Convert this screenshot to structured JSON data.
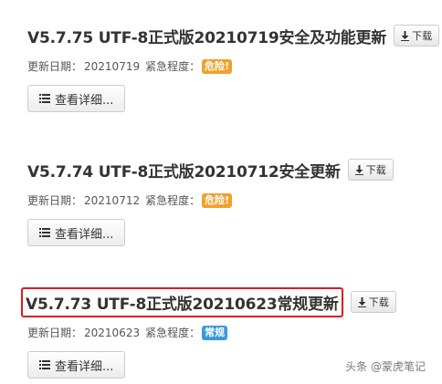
{
  "labels": {
    "update_date": "更新日期：",
    "urgency": "紧急程度：",
    "download": "下载",
    "details": "查看详细..."
  },
  "entries": [
    {
      "title": "V5.7.75 UTF-8正式版20210719安全及功能更新",
      "date": "20210719",
      "urgency": "危险!",
      "urgency_color": "#f0a12c"
    },
    {
      "title": "V5.7.74 UTF-8正式版20210712安全更新",
      "date": "20210712",
      "urgency": "危险!",
      "urgency_color": "#f0a12c"
    },
    {
      "title": "V5.7.73 UTF-8正式版20210623常规更新",
      "date": "20210623",
      "urgency": "常规",
      "urgency_color": "#3a9ad9"
    }
  ],
  "watermark": {
    "text": "头条 @蒙虎笔记"
  },
  "colors": {
    "highlight_border": "#e0191f"
  },
  "icons": {
    "download": "download-icon",
    "details": "list-icon"
  }
}
